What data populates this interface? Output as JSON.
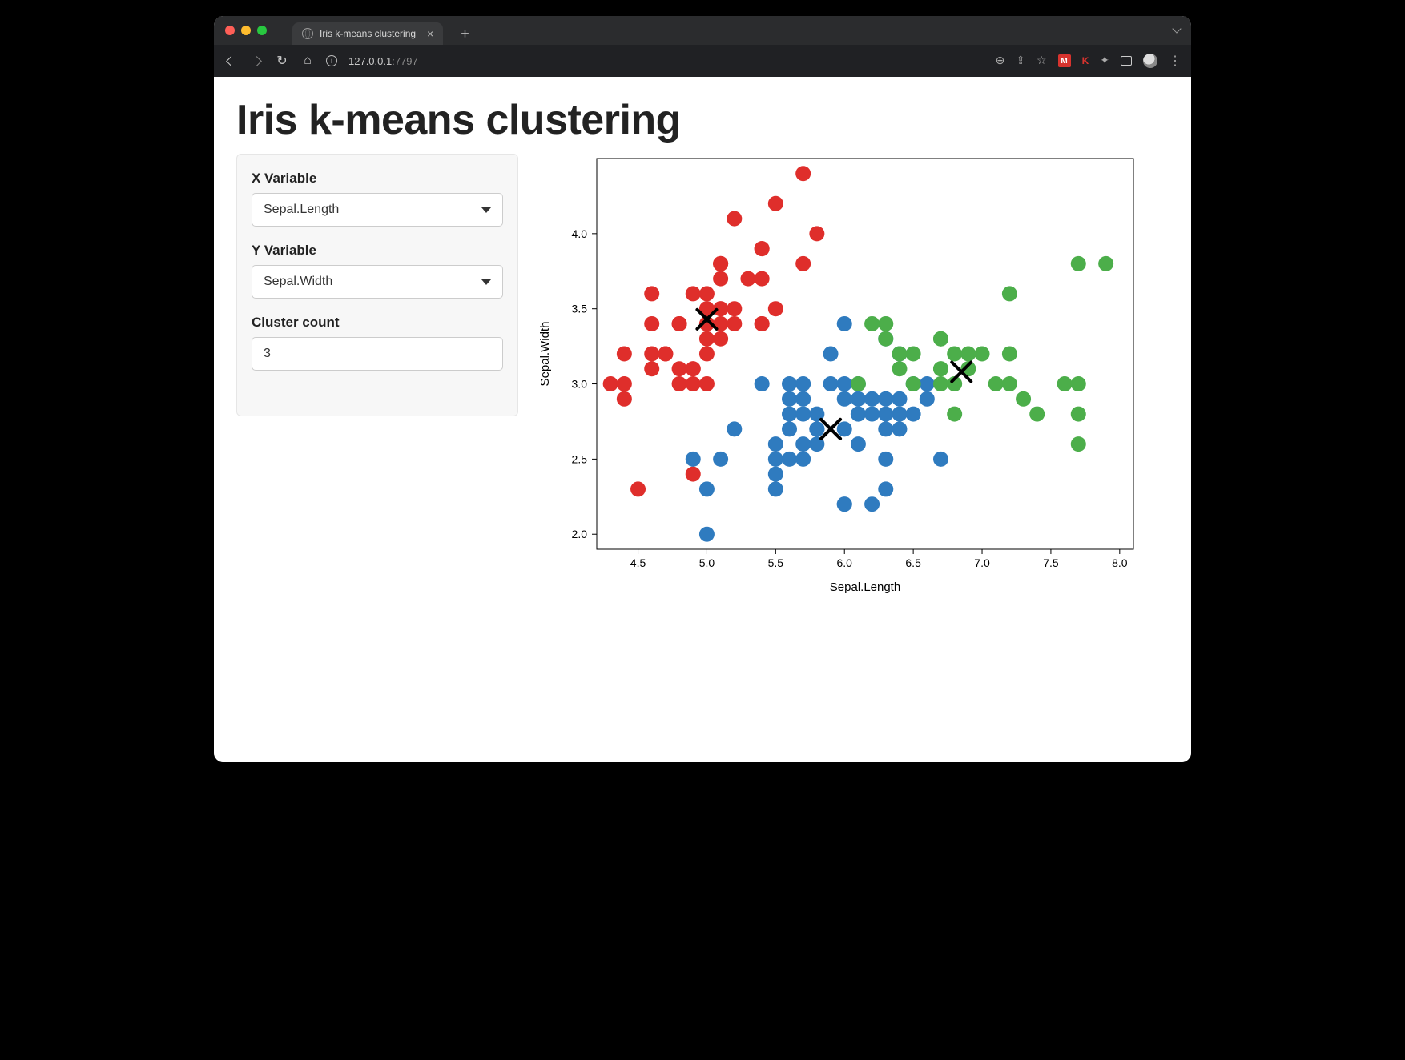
{
  "browser": {
    "tab_title": "Iris k-means clustering",
    "url_host": "127.0.0.1",
    "url_port": ":7797"
  },
  "page": {
    "title": "Iris k-means clustering"
  },
  "sidebar": {
    "xvar_label": "X Variable",
    "xvar_value": "Sepal.Length",
    "yvar_label": "Y Variable",
    "yvar_value": "Sepal.Width",
    "cluster_label": "Cluster count",
    "cluster_value": "3"
  },
  "chart_data": {
    "type": "scatter",
    "xlabel": "Sepal.Length",
    "ylabel": "Sepal.Width",
    "xlim": [
      4.2,
      8.1
    ],
    "ylim": [
      1.9,
      4.5
    ],
    "x_ticks": [
      4.5,
      5.0,
      5.5,
      6.0,
      6.5,
      7.0,
      7.5,
      8.0
    ],
    "y_ticks": [
      2.0,
      2.5,
      3.0,
      3.5,
      4.0
    ],
    "colors": {
      "red": "#df2e2b",
      "blue": "#2f7bbf",
      "green": "#4cae4a"
    },
    "series": [
      {
        "name": "cluster-red",
        "color": "red",
        "points": [
          [
            4.3,
            3.0
          ],
          [
            4.4,
            3.0
          ],
          [
            4.4,
            3.2
          ],
          [
            4.4,
            2.9
          ],
          [
            4.5,
            2.3
          ],
          [
            4.6,
            3.4
          ],
          [
            4.6,
            3.6
          ],
          [
            4.6,
            3.1
          ],
          [
            4.6,
            3.2
          ],
          [
            4.7,
            3.2
          ],
          [
            4.7,
            3.2
          ],
          [
            4.8,
            3.0
          ],
          [
            4.8,
            3.1
          ],
          [
            4.8,
            3.4
          ],
          [
            4.8,
            3.4
          ],
          [
            4.9,
            3.1
          ],
          [
            4.9,
            3.0
          ],
          [
            4.9,
            3.1
          ],
          [
            4.9,
            3.6
          ],
          [
            5.0,
            3.6
          ],
          [
            5.0,
            3.4
          ],
          [
            5.0,
            3.5
          ],
          [
            5.0,
            3.0
          ],
          [
            5.0,
            3.2
          ],
          [
            5.0,
            3.3
          ],
          [
            5.0,
            3.4
          ],
          [
            5.0,
            3.5
          ],
          [
            5.1,
            3.3
          ],
          [
            5.1,
            3.5
          ],
          [
            5.1,
            3.7
          ],
          [
            5.1,
            3.8
          ],
          [
            5.1,
            3.8
          ],
          [
            5.1,
            3.4
          ],
          [
            5.1,
            3.5
          ],
          [
            5.1,
            3.8
          ],
          [
            5.2,
            3.5
          ],
          [
            5.2,
            3.4
          ],
          [
            5.2,
            4.1
          ],
          [
            5.3,
            3.7
          ],
          [
            5.4,
            3.9
          ],
          [
            5.4,
            3.4
          ],
          [
            5.4,
            3.7
          ],
          [
            5.4,
            3.9
          ],
          [
            5.4,
            3.4
          ],
          [
            5.5,
            3.5
          ],
          [
            5.5,
            4.2
          ],
          [
            5.7,
            3.8
          ],
          [
            5.7,
            4.4
          ],
          [
            5.8,
            4.0
          ],
          [
            4.9,
            2.4
          ]
        ]
      },
      {
        "name": "cluster-blue",
        "color": "blue",
        "points": [
          [
            4.9,
            2.5
          ],
          [
            5.0,
            2.0
          ],
          [
            5.0,
            2.3
          ],
          [
            5.1,
            2.5
          ],
          [
            5.2,
            2.7
          ],
          [
            5.4,
            3.0
          ],
          [
            5.5,
            2.5
          ],
          [
            5.5,
            2.3
          ],
          [
            5.5,
            2.4
          ],
          [
            5.5,
            2.6
          ],
          [
            5.6,
            2.5
          ],
          [
            5.6,
            3.0
          ],
          [
            5.6,
            2.9
          ],
          [
            5.6,
            2.7
          ],
          [
            5.6,
            2.8
          ],
          [
            5.7,
            3.0
          ],
          [
            5.7,
            2.6
          ],
          [
            5.7,
            2.8
          ],
          [
            5.7,
            2.9
          ],
          [
            5.7,
            2.5
          ],
          [
            5.8,
            2.8
          ],
          [
            5.8,
            2.7
          ],
          [
            5.8,
            2.7
          ],
          [
            5.8,
            2.6
          ],
          [
            5.8,
            2.7
          ],
          [
            5.9,
            3.0
          ],
          [
            5.9,
            3.2
          ],
          [
            6.0,
            2.2
          ],
          [
            6.0,
            2.7
          ],
          [
            6.0,
            2.9
          ],
          [
            6.0,
            3.0
          ],
          [
            6.0,
            2.2
          ],
          [
            6.0,
            3.4
          ],
          [
            6.1,
            3.0
          ],
          [
            6.1,
            2.8
          ],
          [
            6.1,
            2.9
          ],
          [
            6.1,
            2.8
          ],
          [
            6.1,
            2.6
          ],
          [
            6.2,
            2.2
          ],
          [
            6.2,
            2.8
          ],
          [
            6.2,
            2.9
          ],
          [
            6.3,
            2.3
          ],
          [
            6.3,
            2.5
          ],
          [
            6.3,
            2.7
          ],
          [
            6.3,
            2.8
          ],
          [
            6.3,
            3.3
          ],
          [
            6.4,
            2.9
          ],
          [
            6.4,
            2.7
          ],
          [
            6.4,
            2.8
          ],
          [
            6.4,
            3.2
          ],
          [
            6.5,
            2.8
          ],
          [
            6.5,
            3.0
          ],
          [
            6.6,
            2.9
          ],
          [
            6.6,
            3.0
          ],
          [
            6.7,
            2.5
          ],
          [
            6.3,
            2.9
          ]
        ]
      },
      {
        "name": "cluster-green",
        "color": "green",
        "points": [
          [
            6.1,
            3.0
          ],
          [
            6.2,
            3.4
          ],
          [
            6.3,
            3.4
          ],
          [
            6.3,
            3.3
          ],
          [
            6.4,
            3.1
          ],
          [
            6.4,
            3.2
          ],
          [
            6.5,
            3.2
          ],
          [
            6.5,
            3.0
          ],
          [
            6.7,
            3.0
          ],
          [
            6.7,
            3.3
          ],
          [
            6.7,
            3.1
          ],
          [
            6.7,
            3.3
          ],
          [
            6.7,
            3.1
          ],
          [
            6.8,
            2.8
          ],
          [
            6.8,
            3.0
          ],
          [
            6.8,
            3.2
          ],
          [
            6.9,
            3.1
          ],
          [
            6.9,
            3.2
          ],
          [
            6.9,
            3.1
          ],
          [
            7.0,
            3.2
          ],
          [
            7.1,
            3.0
          ],
          [
            7.2,
            3.2
          ],
          [
            7.2,
            3.0
          ],
          [
            7.2,
            3.6
          ],
          [
            7.3,
            2.9
          ],
          [
            7.4,
            2.8
          ],
          [
            7.6,
            3.0
          ],
          [
            7.7,
            2.6
          ],
          [
            7.7,
            3.0
          ],
          [
            7.7,
            2.8
          ],
          [
            7.7,
            3.8
          ],
          [
            7.9,
            3.8
          ]
        ]
      }
    ],
    "centroids": [
      [
        5.0,
        3.43
      ],
      [
        5.9,
        2.7
      ],
      [
        6.85,
        3.08
      ]
    ]
  }
}
